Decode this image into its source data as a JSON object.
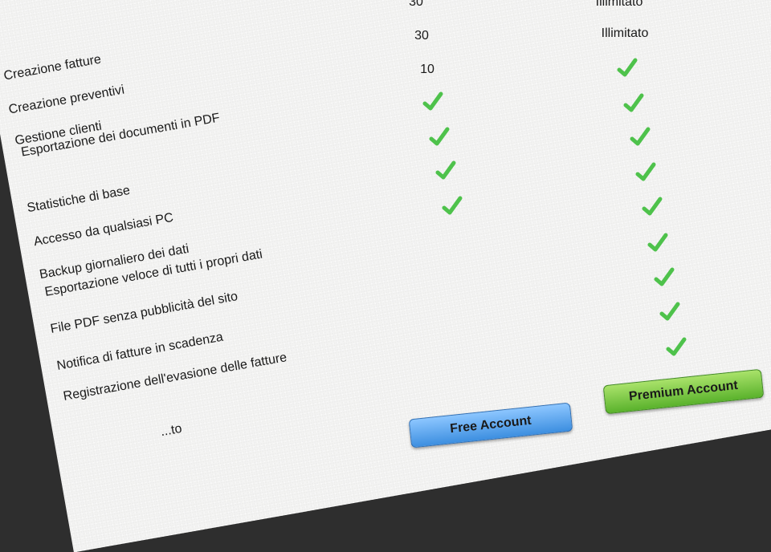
{
  "colors": {
    "check": "#4ec24b",
    "free_button": "#3d8fe0",
    "premium_button": "#5ab22c"
  },
  "columns": {
    "free": {
      "top_values": [
        "30",
        "30",
        "10"
      ],
      "button_label": "Free Account"
    },
    "premium": {
      "top_values": [
        "Illimitato",
        "Illimitato"
      ],
      "button_label": "Premium Account"
    }
  },
  "features": [
    {
      "label": "Creazione fatture",
      "free": "10",
      "premium": "check"
    },
    {
      "label": "Creazione preventivi",
      "free": "check",
      "premium": "check"
    },
    {
      "label": "Gestione clienti",
      "free": "check",
      "premium": "check"
    },
    {
      "label": "Esportazione dei documenti in PDF",
      "free": "check",
      "premium": "check"
    },
    {
      "label": "Statistiche di base",
      "free": "check",
      "premium": "check"
    },
    {
      "label": "Accesso da qualsiasi PC",
      "free": "",
      "premium": "check"
    },
    {
      "label": "Backup giornaliero dei dati",
      "free": "",
      "premium": "check"
    },
    {
      "label": "Esportazione veloce di tutti i propri dati",
      "free": "",
      "premium": "check"
    },
    {
      "label": "File PDF senza pubblicità del sito",
      "free": "",
      "premium": "check"
    },
    {
      "label": "Notifica di fatture in scadenza",
      "free": "",
      "premium": "check"
    },
    {
      "label": "Registrazione dell'evasione delle fatture",
      "free": "",
      "premium": ""
    }
  ],
  "partial_label": "...to"
}
